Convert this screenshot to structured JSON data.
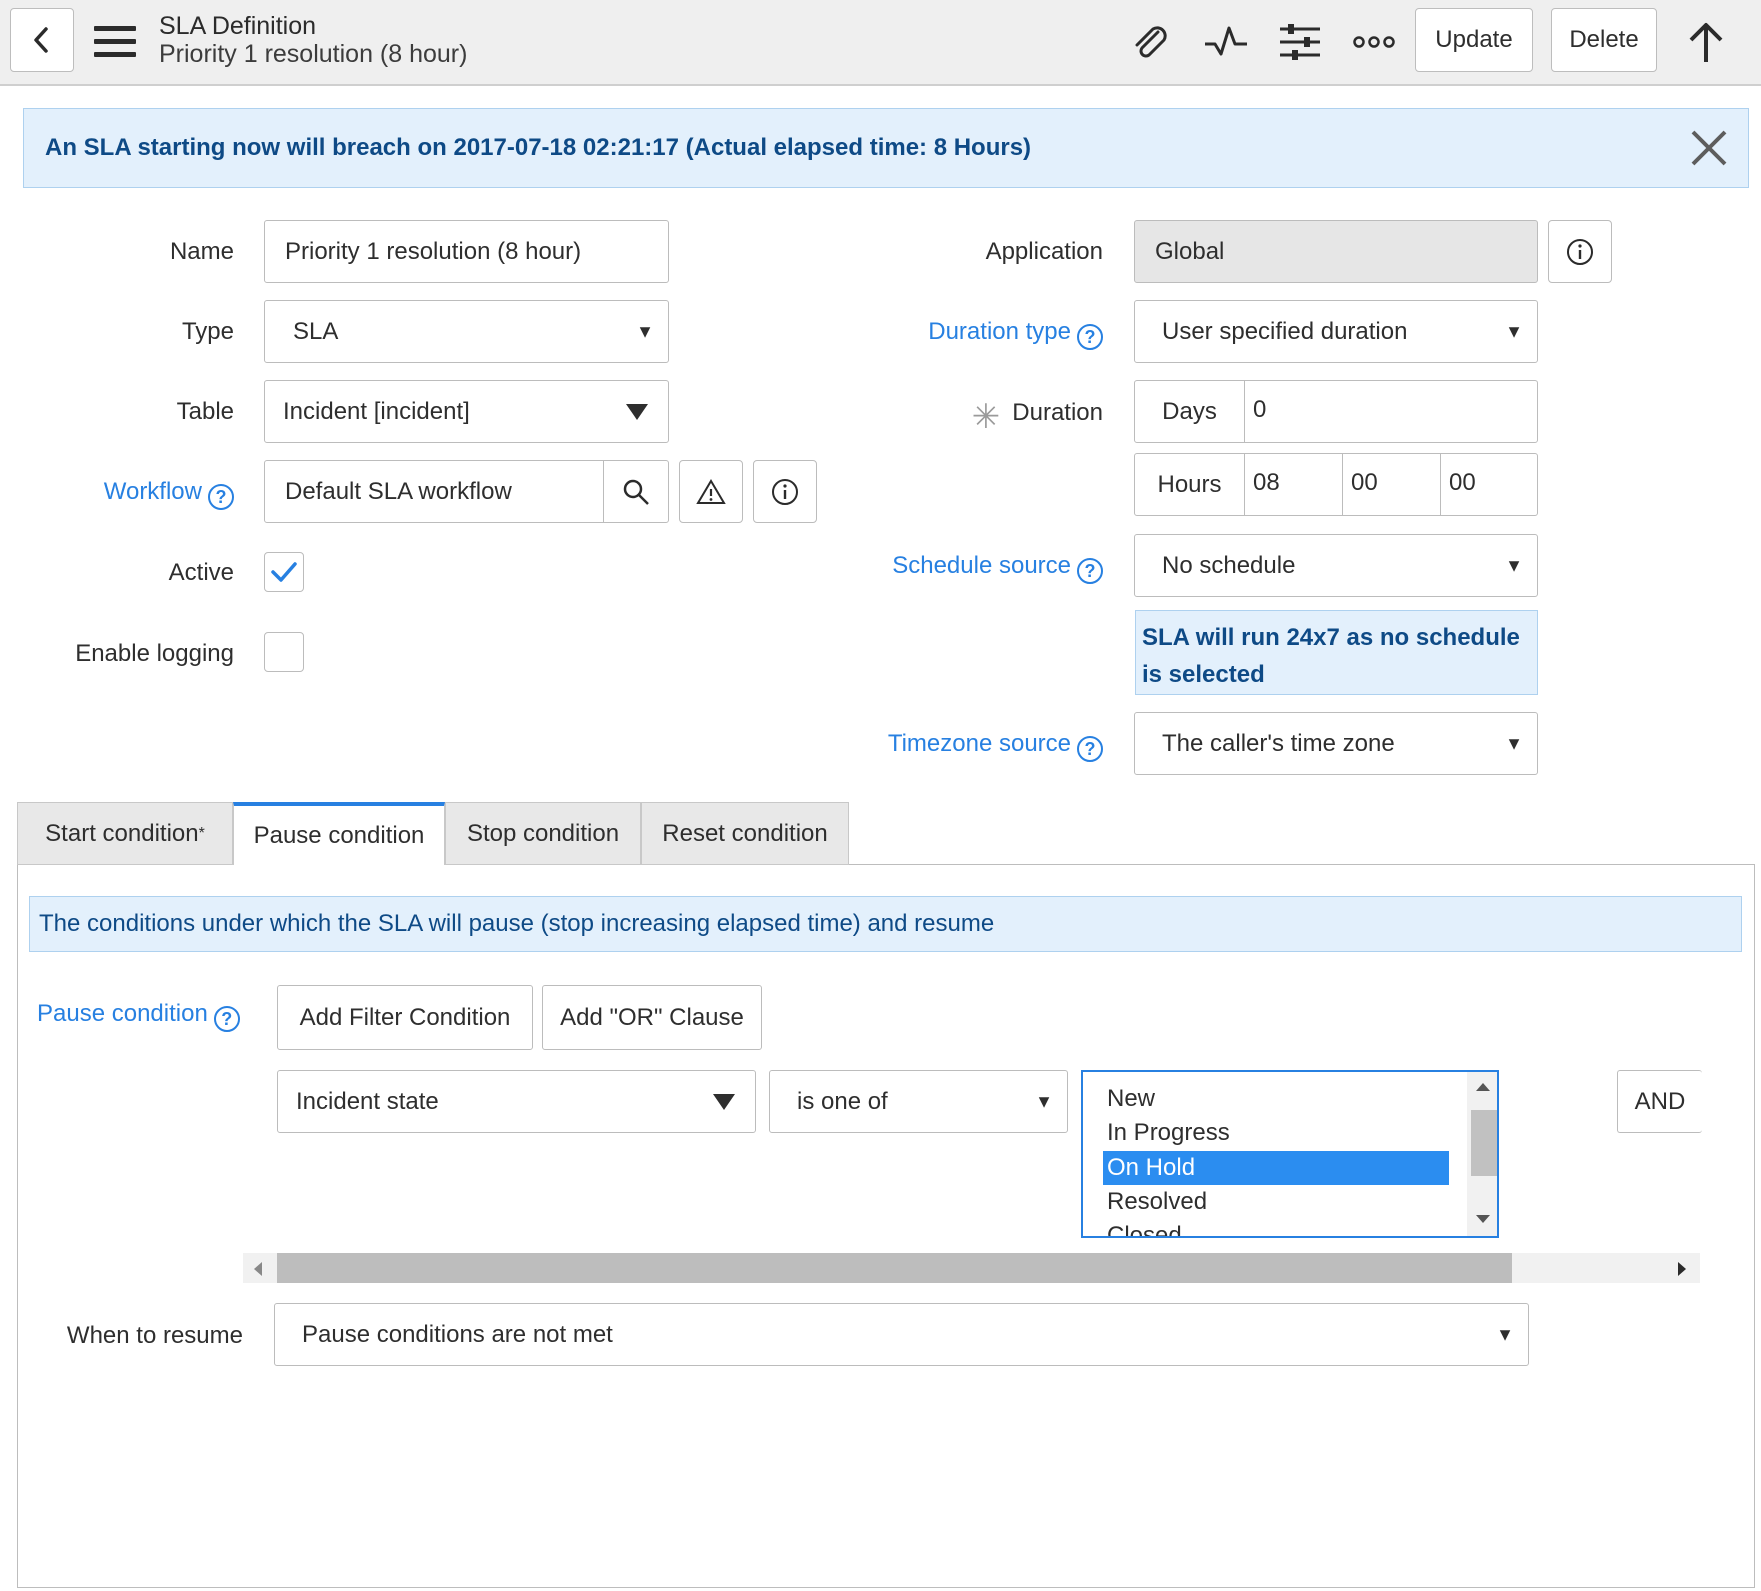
{
  "header": {
    "title": "SLA Definition",
    "subtitle": "Priority 1 resolution (8 hour)",
    "update_label": "Update",
    "delete_label": "Delete",
    "icons": [
      "back-icon",
      "menu-icon",
      "attachment-icon",
      "activity-icon",
      "settings-icon",
      "more-icon",
      "up-arrow-icon"
    ]
  },
  "banner": {
    "text": "An SLA starting now will breach on 2017-07-18 02:21:17 (Actual elapsed time: 8 Hours)"
  },
  "form": {
    "name_label": "Name",
    "name_value": "Priority 1 resolution (8 hour)",
    "type_label": "Type",
    "type_value": "SLA",
    "table_label": "Table",
    "table_value": "Incident [incident]",
    "workflow_label": "Workflow",
    "workflow_value": "Default SLA workflow",
    "active_label": "Active",
    "active_checked": true,
    "logging_label": "Enable logging",
    "logging_checked": false,
    "application_label": "Application",
    "application_value": "Global",
    "duration_type_label": "Duration type",
    "duration_type_value": "User specified duration",
    "duration_label": "Duration",
    "days_label": "Days",
    "days_value": "0",
    "hours_label": "Hours",
    "hours_value": "08",
    "minutes_value": "00",
    "seconds_value": "00",
    "schedule_source_label": "Schedule source",
    "schedule_source_value": "No schedule",
    "schedule_note": "SLA will run 24x7 as no schedule is selected",
    "timezone_source_label": "Timezone source",
    "timezone_source_value": "The caller's time zone"
  },
  "tabs": [
    {
      "label": "Start condition",
      "mark": "*"
    },
    {
      "label": "Pause condition"
    },
    {
      "label": "Stop condition"
    },
    {
      "label": "Reset condition"
    }
  ],
  "pause_panel": {
    "note": "The conditions under which the SLA will pause (stop increasing elapsed time) and resume",
    "condition_label": "Pause condition",
    "add_filter_label": "Add Filter Condition",
    "add_or_label": "Add \"OR\" Clause",
    "field_value": "Incident state",
    "operator_value": "is one of",
    "options": [
      "New",
      "In Progress",
      "On Hold",
      "Resolved",
      "Closed"
    ],
    "selected_option": "On Hold",
    "and_label": "AND",
    "resume_label": "When to resume",
    "resume_value": "Pause conditions are not met"
  },
  "colors": {
    "accent": "#2780e1",
    "banner_bg": "#e3f0fc",
    "banner_text": "#0e4a86",
    "selected_bg": "#2b8df0"
  }
}
